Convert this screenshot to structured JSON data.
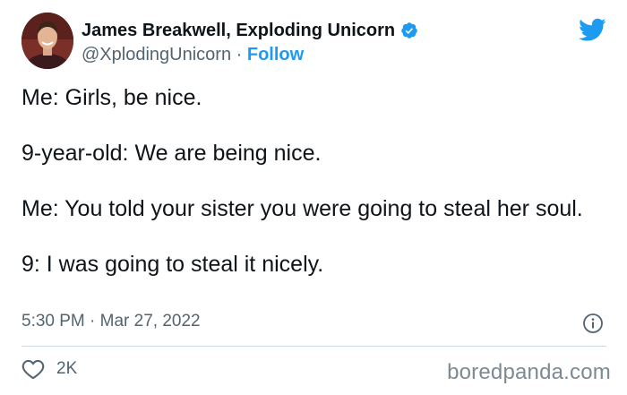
{
  "author": {
    "display_name": "James Breakwell, Exploding Unicorn",
    "handle": "@XplodingUnicorn",
    "separator": "·",
    "follow_label": "Follow",
    "verified_icon": "verified-badge-icon",
    "avatar_icon": "profile-photo"
  },
  "tweet": {
    "paragraphs": [
      "Me: Girls, be nice.",
      "9-year-old: We are being nice.",
      "Me: You told your sister you were going to steal her soul.",
      "9: I was going to steal it nicely."
    ],
    "time": "5:30 PM",
    "date_separator": "·",
    "date": "Mar 27, 2022"
  },
  "engagement": {
    "likes": "2K",
    "like_icon": "heart-icon",
    "info_icon": "info-icon"
  },
  "branding": {
    "platform_icon": "twitter-bird-icon",
    "watermark": "boredpanda.com"
  },
  "colors": {
    "accent": "#1d9bf0",
    "text": "#0f1419",
    "secondary": "#536471",
    "divider": "#cfd9de",
    "watermark": "#7d8a93"
  }
}
